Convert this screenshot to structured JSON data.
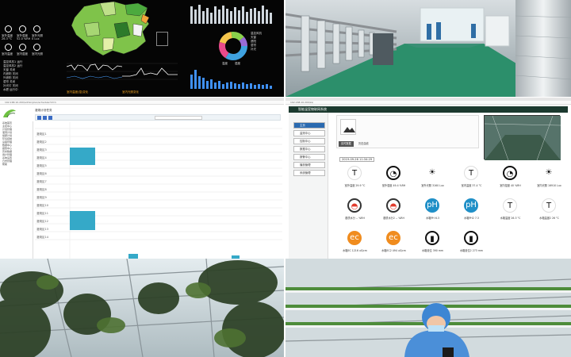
{
  "dashboard": {
    "left_labels": [
      "室外温度",
      "室外湿度",
      "室外光照",
      "室内温度",
      "室内湿度",
      "室内光照"
    ],
    "left_values": [
      "26.3 °C",
      "52.0 %RH",
      "0 Lux",
      "29.5 °C",
      "50.3 %RH",
      "0 Lux"
    ],
    "log_lines": [
      "温控风机1 运行",
      "温控风机2 运行",
      "天窗 关闭",
      "内遮阳 关闭",
      "外遮阳 关闭",
      "湿帘 关闭",
      "补光灯 关闭",
      "水肥 运行中"
    ],
    "chart_caption_left": "室内温度(湿)变化",
    "chart_caption_right": "室内光照变化",
    "pie_legend": [
      "温控风机",
      "天窗",
      "遮阳",
      "湿帘",
      "补光"
    ],
    "chart_legend": [
      "温度",
      "湿度"
    ]
  },
  "browser3": {
    "address": "192.168.10.200/admin/plan/schedule?id=1",
    "page_title": "灌溉计划任务",
    "menu_items": [
      "系统首页",
      "主控中心",
      "计划管理",
      "灌溉计划",
      "施肥计划",
      "环境控制",
      "设备管理",
      "数据中心",
      "报警中心",
      "历史数据",
      "用户管理",
      "系统设置",
      "日志管理",
      "帮助"
    ],
    "rows": [
      "灌溉区1",
      "灌溉区2",
      "灌溉区3",
      "灌溉区4",
      "灌溉区5",
      "灌溉区6",
      "灌溉区7",
      "灌溉区8",
      "灌溉区9",
      "灌溉区10",
      "灌溉区11",
      "灌溉区12",
      "灌溉区13",
      "灌溉区14"
    ]
  },
  "browser4": {
    "address": "192.168.10.200/zs/",
    "app_title": "智能温室物联网系统",
    "menu": [
      "主页",
      "监测中心",
      "控制中心",
      "数据中心",
      "报警中心",
      "播放管理",
      "系统管理"
    ],
    "timestamp": "2019-09-26 11:34:29",
    "tabs": [
      "实时数据",
      "历史曲线"
    ],
    "sensors": [
      {
        "name": "室外温度",
        "value": "29.9 °C",
        "glyph": "T",
        "kind": "thermo"
      },
      {
        "name": "室外湿度",
        "value": "49.4 %RH",
        "glyph": "◔",
        "kind": "gauge"
      },
      {
        "name": "室外光照",
        "value": "3160 Lux",
        "glyph": "☀",
        "kind": "sun"
      },
      {
        "name": "室内温度",
        "value": "37.4 °C",
        "glyph": "T",
        "kind": "thermo"
      },
      {
        "name": "室内湿度",
        "value": "40 %RH",
        "glyph": "◔",
        "kind": "gauge"
      },
      {
        "name": "室内光照",
        "value": "16910 Lux",
        "glyph": "☀",
        "kind": "sun"
      },
      {
        "name": "基质水分",
        "value": "-- %RH",
        "glyph": "◓",
        "kind": "meter"
      },
      {
        "name": "基质水分2",
        "value": "-- %RH",
        "glyph": "◓",
        "kind": "meter"
      },
      {
        "name": "水箱PH",
        "value": "6.3",
        "glyph": "pH",
        "kind": "ph"
      },
      {
        "name": "水箱PH2",
        "value": "7.3",
        "glyph": "pH",
        "kind": "ph"
      },
      {
        "name": "水箱温度",
        "value": "26.3 °C",
        "glyph": "T",
        "kind": "thermo"
      },
      {
        "name": "水箱温度2",
        "value": "26 °C",
        "glyph": "T",
        "kind": "thermo"
      },
      {
        "name": "水箱EC",
        "value": "1216 uS/cm",
        "glyph": "ec",
        "kind": "ec"
      },
      {
        "name": "水箱EC2",
        "value": "494 uS/cm",
        "glyph": "ec",
        "kind": "ec"
      },
      {
        "name": "水箱液位",
        "value": "390 mm",
        "glyph": "▮",
        "kind": "level"
      },
      {
        "name": "水箱液位2",
        "value": "273 mm",
        "glyph": "▮",
        "kind": "level"
      }
    ]
  },
  "colors": {
    "accent": "#1f8fc7",
    "nav_blue": "#2a6ab0",
    "ec_orange": "#f08c1e",
    "dark_green": "#1c3a2f"
  }
}
